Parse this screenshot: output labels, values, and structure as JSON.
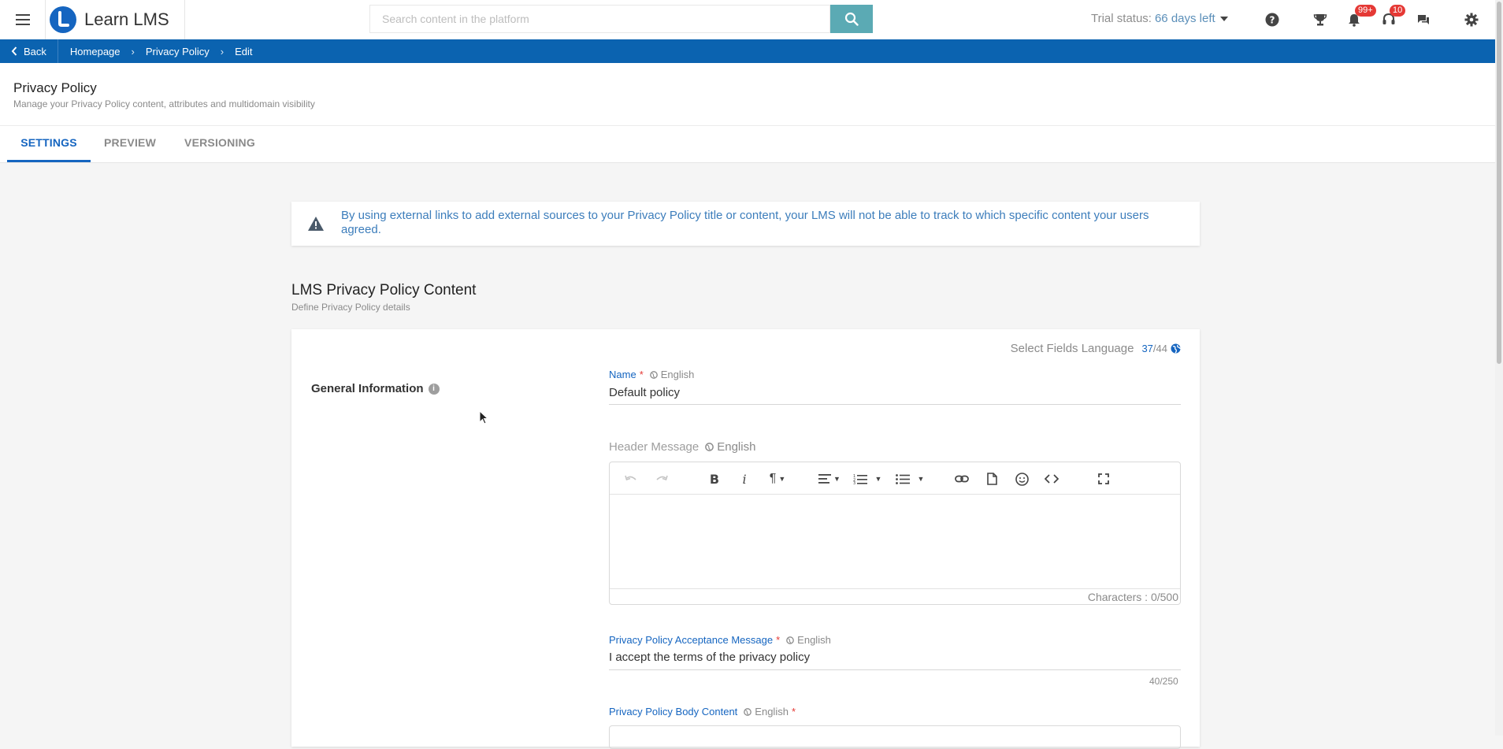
{
  "app": {
    "name": "Learn LMS"
  },
  "search": {
    "placeholder": "Search content in the platform"
  },
  "trial": {
    "label": "Trial status:",
    "days": "66 days left"
  },
  "badges": {
    "notifications": "99+",
    "messages": "10"
  },
  "breadcrumb": {
    "back": "Back",
    "items": [
      "Homepage",
      "Privacy Policy",
      "Edit"
    ]
  },
  "page": {
    "title": "Privacy Policy",
    "subtitle": "Manage your Privacy Policy content, attributes and multidomain visibility"
  },
  "tabs": [
    "SETTINGS",
    "PREVIEW",
    "VERSIONING"
  ],
  "alert": {
    "text": "By using external links to add external sources to your Privacy Policy title or content, your LMS will not be able to track to which specific content your users agreed."
  },
  "section": {
    "title": "LMS Privacy Policy Content",
    "subtitle": "Define Privacy Policy details"
  },
  "form": {
    "select_language": "Select Fields Language",
    "lang_count": "37",
    "lang_total": "/44",
    "group_title": "General Information",
    "name": {
      "label": "Name",
      "lang": "English",
      "value": "Default policy"
    },
    "header_message": {
      "label": "Header Message",
      "lang": "English",
      "chars": "Characters : 0/500"
    },
    "acceptance": {
      "label": "Privacy Policy Acceptance Message",
      "lang": "English",
      "value": "I accept the terms of the privacy policy",
      "counter": "40/250"
    },
    "body": {
      "label": "Privacy Policy Body Content",
      "lang": "English"
    }
  },
  "colors": {
    "brand": "#1565c0",
    "crumb_bar": "#0b63b0",
    "search_button": "#5baab4",
    "badge": "#e53935"
  }
}
